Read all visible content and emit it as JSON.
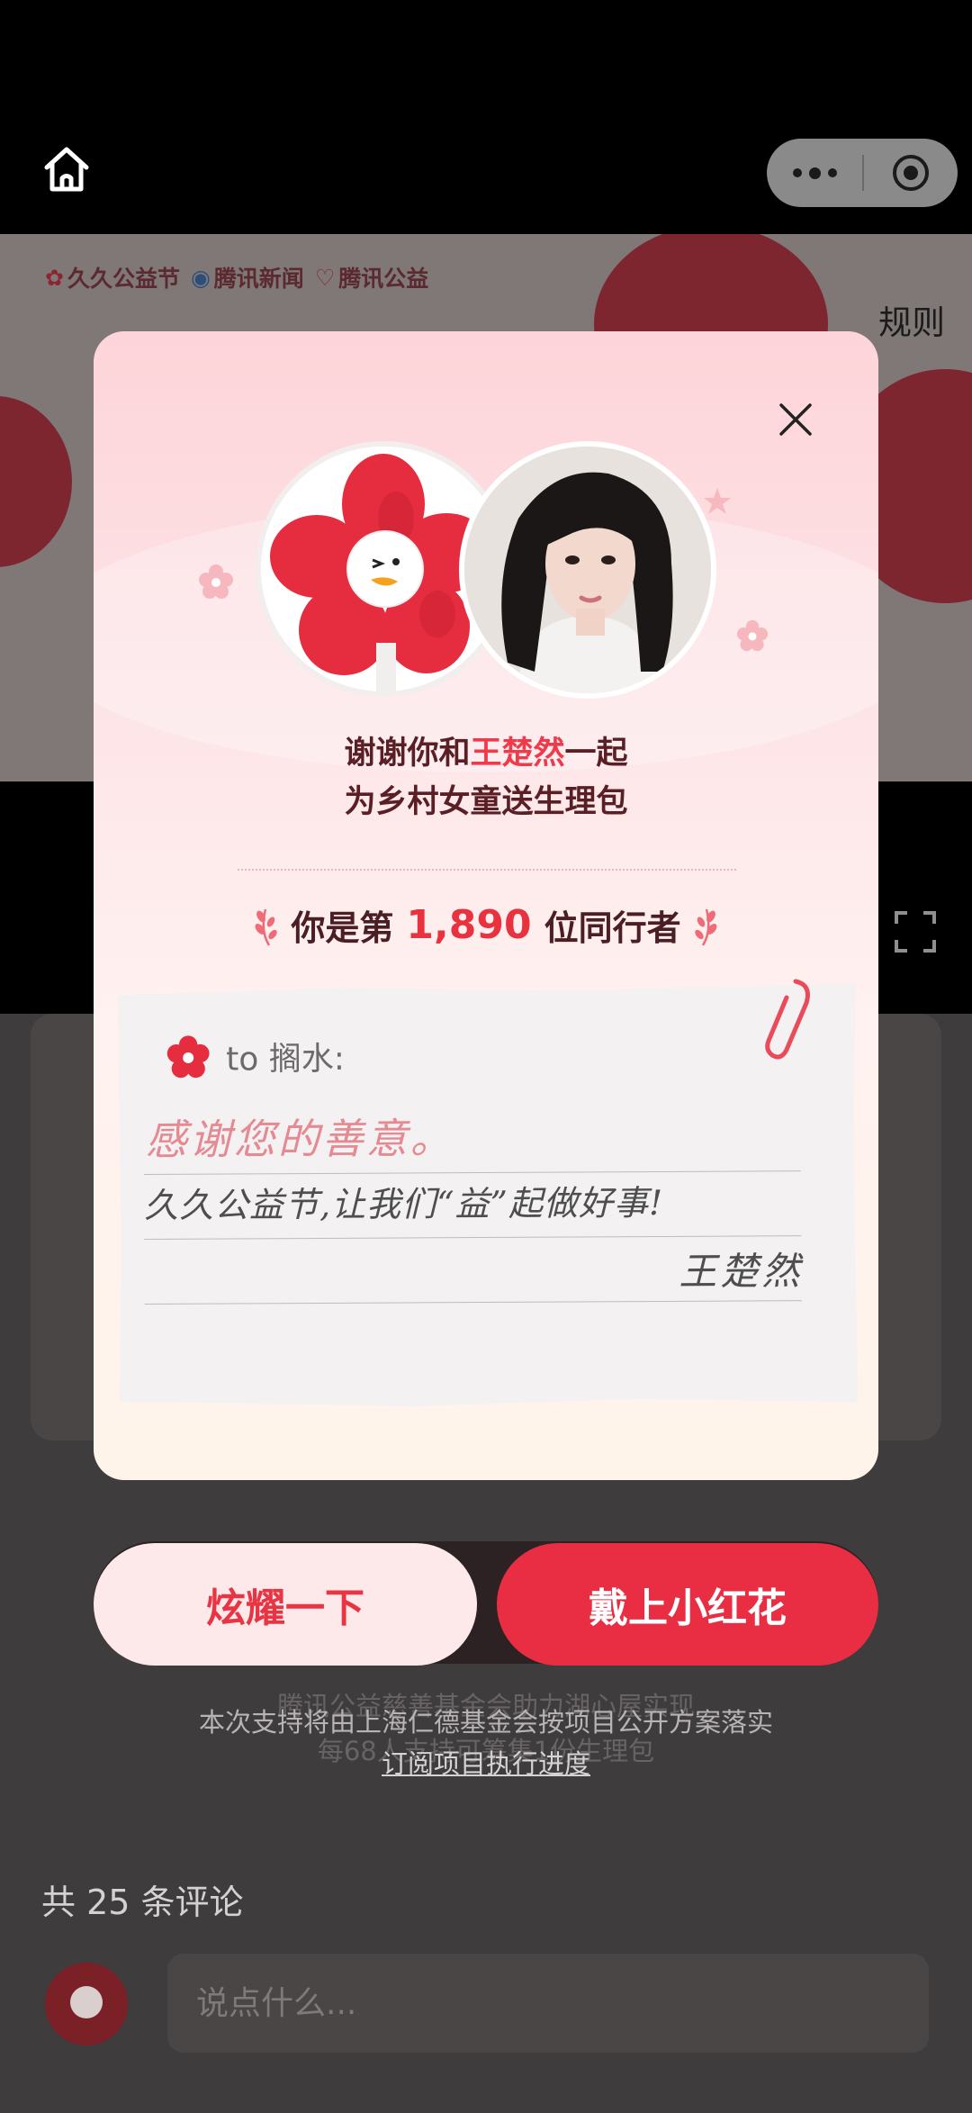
{
  "topbar": {
    "home_icon": "home-icon",
    "capsule": {
      "more_icon": "more-dots-icon",
      "record_icon": "record-target-icon"
    }
  },
  "banner": {
    "brands": [
      "久久公益节",
      "腾讯新闻",
      "腾讯公益"
    ],
    "rules_label": "规则"
  },
  "modal": {
    "thanks_pre": "谢谢你和",
    "celebrity": "王楚然",
    "thanks_post": "一起",
    "thanks_line2": "为乡村女童送生理包",
    "rank_pre": "你是第",
    "rank_number": "1,890",
    "rank_post": "位同行者",
    "note": {
      "to_label": "to 搁水:",
      "line1": "感谢您的善意。",
      "line2": "久久公益节,让我们“益”起做好事!",
      "signature": "王楚然"
    }
  },
  "actions": {
    "show_off": "炫耀一下",
    "wear_flower": "戴上小红花"
  },
  "footer": {
    "bg_line1": "腾讯公益慈善基金会助力湖心屋实现",
    "bg_line2": "每68人支持可筹集1份生理包",
    "support_text": "本次支持将由上海仁德基金会按项目公开方案落实",
    "subscribe_link": "订阅项目执行进度"
  },
  "comments": {
    "title": "共 25 条评论",
    "placeholder": "说点什么..."
  },
  "colors": {
    "accent": "#e92d43",
    "highlight": "#ef3a4b",
    "modal_bg": "#fde3e6"
  }
}
